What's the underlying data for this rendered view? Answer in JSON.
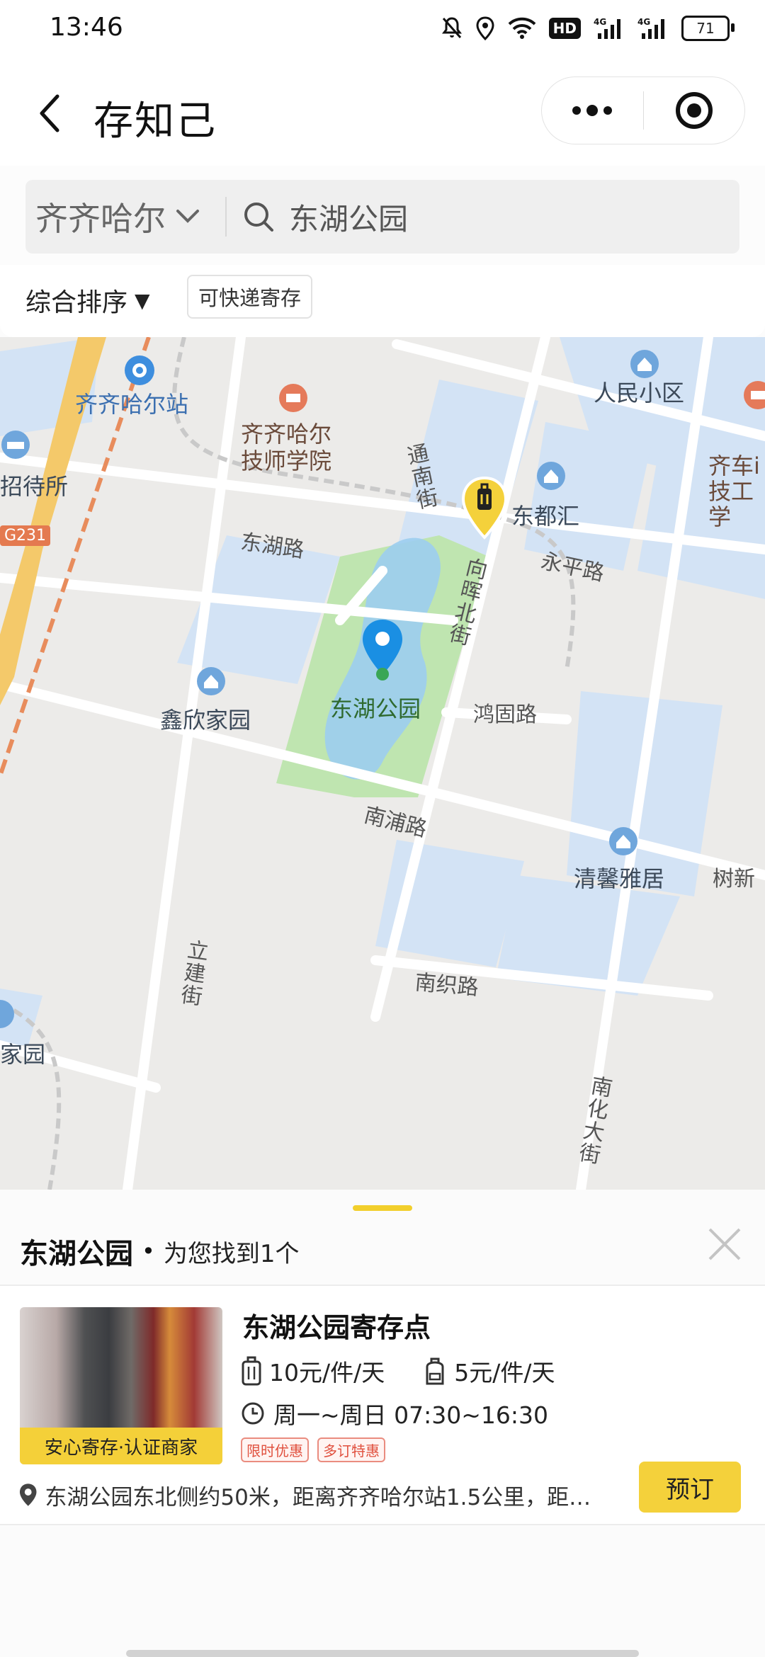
{
  "status_bar": {
    "time": "13:46",
    "icons": [
      "bell-off-icon",
      "location-icon",
      "wifi-icon",
      "hd-icon",
      "signal-4g-icon",
      "signal-4g-icon"
    ],
    "hd_label": "HD",
    "net1": "4G",
    "net2": "4G",
    "battery": "71"
  },
  "header": {
    "title": "存知己",
    "back_icon": "chevron-left-icon",
    "menu_icon": "more-dots-icon",
    "target_icon": "target-icon"
  },
  "search": {
    "city": "齐齐哈尔",
    "query": "东湖公园"
  },
  "filters": {
    "sort_label": "综合排序",
    "sort_arrow": "▼",
    "chip_label": "可快递寄存"
  },
  "map": {
    "labels": {
      "station": "齐齐哈尔站",
      "school_line1": "齐齐哈尔",
      "school_line2": "技师学院",
      "renmin": "人民小区",
      "qiche_line1": "齐车i",
      "qiche_line2": "技工学",
      "zhaodaisuo": "招待所",
      "g231": "G231",
      "tongnan": "通南街",
      "dongduhui": "东都汇",
      "donghulu": "东湖路",
      "yongping": "永平路",
      "xianghuibei": "向晖北街",
      "xinxin": "鑫欣家园",
      "park": "东湖公园",
      "honggu": "鸿固路",
      "nanpu": "南浦路",
      "qingxin": "清馨雅居",
      "shuxin": "树新",
      "lijian": "立建街",
      "nanzhi": "南织路",
      "jiayuan": "家园",
      "nanhua": "南化大街"
    }
  },
  "sheet": {
    "place": "东湖公园",
    "dot": "•",
    "count_text": "为您找到1个",
    "close_icon": "close-icon"
  },
  "result": {
    "name": "东湖公园寄存点",
    "badge": "安心寄存·认证商家",
    "price_large": "10元/件/天",
    "price_small": "5元/件/天",
    "hours": "周一~周日 07:30~16:30",
    "tags": [
      "限时优惠",
      "多订特惠"
    ],
    "address": "东湖公园东北侧约50米，距离齐齐哈尔站1.5公里，距…",
    "book_label": "预订"
  },
  "colors": {
    "accent": "#f4d13b",
    "park": "#bfe5b0",
    "water": "#d3e3f5",
    "pin_blue": "#1a8fe3"
  }
}
